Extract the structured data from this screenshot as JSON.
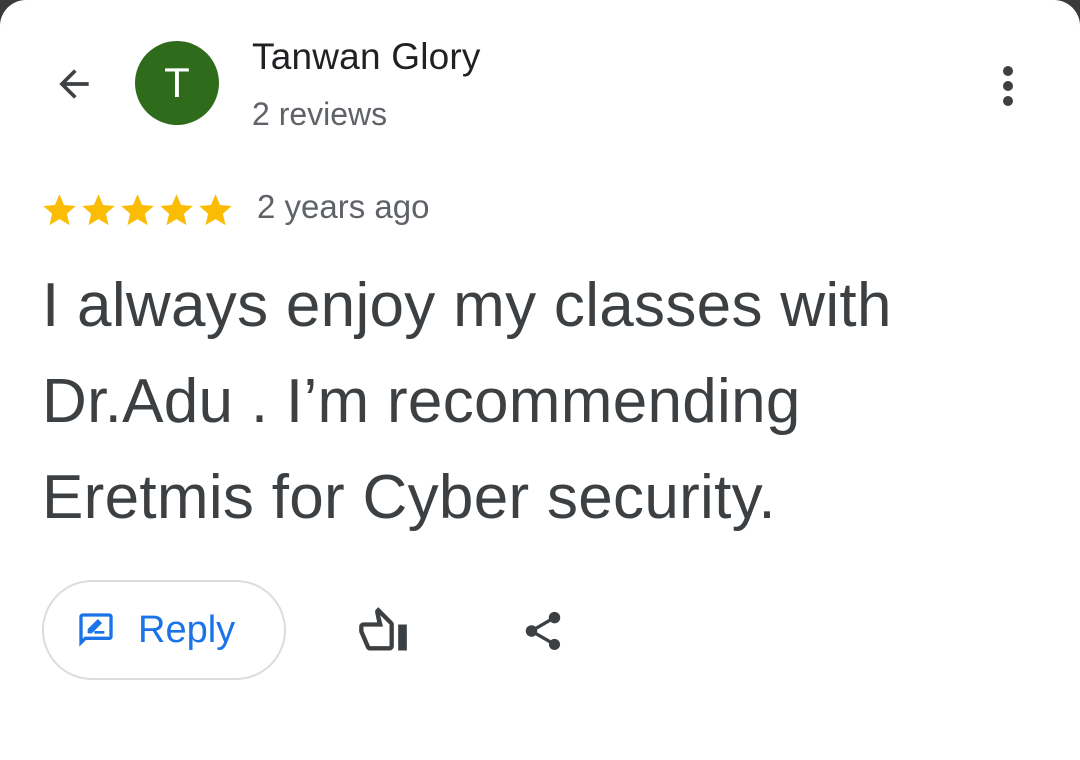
{
  "header": {
    "back_icon": "arrow-back-icon",
    "avatar_letter": "T",
    "avatar_color": "#2e6b1a",
    "reviewer_name": "Tanwan Glory",
    "review_count": "2 reviews",
    "more_icon": "more-vert-icon"
  },
  "review": {
    "rating": 5,
    "max_rating": 5,
    "star_color": "#fbbc04",
    "time_ago": "2 years ago",
    "text_lines": [
      "I always enjoy my classes with",
      "Dr.Adu . I’m recommending",
      "Eretmis for Cyber security."
    ]
  },
  "actions": {
    "reply_label": "Reply",
    "reply_icon": "rate-review-icon",
    "like_icon": "thumb-up-outline-icon",
    "share_icon": "share-icon",
    "accent_color": "#1a73e8"
  }
}
